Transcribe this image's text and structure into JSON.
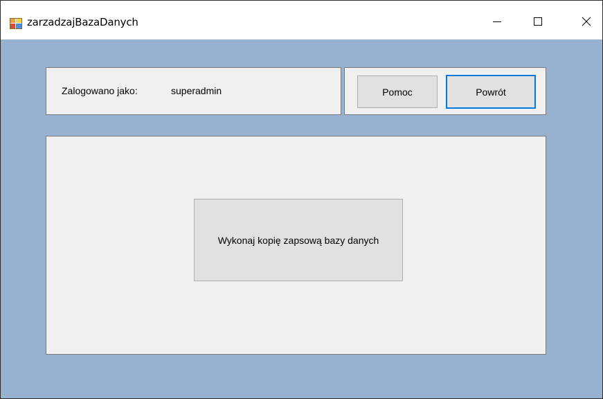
{
  "window": {
    "title": "zarzadzajBazaDanych",
    "icon": "winforms-app-icon",
    "controls": {
      "minimize_icon": "minimize-icon",
      "maximize_icon": "maximize-icon",
      "close_icon": "close-icon"
    }
  },
  "colors": {
    "client_background": "#97b2d0",
    "panel_background": "#f0f0f0",
    "button_background": "#e1e1e1",
    "focus_border": "#0078d7"
  },
  "login_panel": {
    "label": "Zalogowano jako:",
    "username": "superadmin"
  },
  "button_panel": {
    "help_label": "Pomoc",
    "back_label": "Powrót"
  },
  "main_panel": {
    "backup_label": "Wykonaj kopię zapsową bazy danych"
  }
}
